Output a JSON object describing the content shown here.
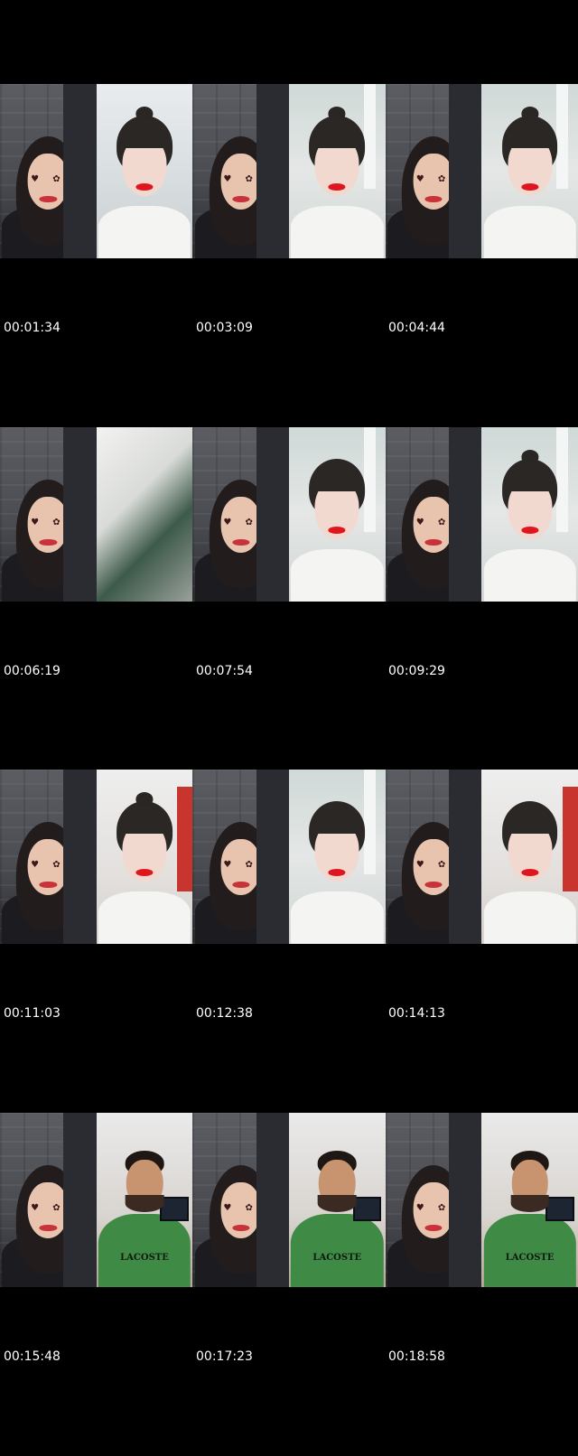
{
  "sheet": {
    "rows": [
      {
        "timestamps": [
          "00:01:34",
          "00:03:09",
          "00:04:44"
        ],
        "frames": [
          {
            "scene": "brick",
            "subject": "long-hair-woman",
            "stickers": true
          },
          {
            "scene": "bright",
            "subject": "bangs-bun-woman",
            "stickers": false
          },
          {
            "scene": "brick",
            "subject": "long-hair-woman",
            "stickers": true
          },
          {
            "scene": "window",
            "subject": "bangs-bun-woman",
            "stickers": false
          },
          {
            "scene": "brick",
            "subject": "long-hair-woman",
            "stickers": true
          },
          {
            "scene": "window",
            "subject": "bangs-bun-woman",
            "stickers": false
          }
        ]
      },
      {
        "timestamps": [
          "00:06:19",
          "00:07:54",
          "00:09:29"
        ],
        "frames": [
          {
            "scene": "brick",
            "subject": "long-hair-woman",
            "stickers": true
          },
          {
            "scene": "blur",
            "subject": "none",
            "stickers": false
          },
          {
            "scene": "brick",
            "subject": "long-hair-woman",
            "stickers": true
          },
          {
            "scene": "window",
            "subject": "bangs-woman",
            "stickers": false
          },
          {
            "scene": "brick",
            "subject": "long-hair-woman",
            "stickers": true
          },
          {
            "scene": "window",
            "subject": "bangs-bun-woman",
            "stickers": false
          }
        ]
      },
      {
        "timestamps": [
          "00:11:03",
          "00:12:38",
          "00:14:13"
        ],
        "frames": [
          {
            "scene": "brick",
            "subject": "long-hair-woman",
            "stickers": true
          },
          {
            "scene": "red",
            "subject": "bangs-bun-woman",
            "stickers": false
          },
          {
            "scene": "brick",
            "subject": "long-hair-woman",
            "stickers": true
          },
          {
            "scene": "window",
            "subject": "bangs-woman",
            "stickers": false
          },
          {
            "scene": "brick",
            "subject": "long-hair-woman",
            "stickers": true
          },
          {
            "scene": "red",
            "subject": "bangs-woman",
            "stickers": false
          }
        ]
      },
      {
        "timestamps": [
          "00:15:48",
          "00:17:23",
          "00:18:58"
        ],
        "frames": [
          {
            "scene": "brick",
            "subject": "long-hair-woman",
            "stickers": true
          },
          {
            "scene": "room",
            "subject": "bearded-man",
            "stickers": false
          },
          {
            "scene": "brick",
            "subject": "long-hair-woman",
            "stickers": true
          },
          {
            "scene": "room",
            "subject": "bearded-man",
            "stickers": false
          },
          {
            "scene": "brick",
            "subject": "long-hair-woman",
            "stickers": true
          },
          {
            "scene": "room",
            "subject": "bearded-man",
            "stickers": false
          }
        ]
      }
    ],
    "shirt_logo": "LACOSTE",
    "sticker_glyphs": "♥ ✿",
    "colors": {
      "background": "#000000",
      "timestamp": "#ffffff",
      "lipstick": "#e0161f",
      "shirt_green": "#3f8a45"
    }
  }
}
